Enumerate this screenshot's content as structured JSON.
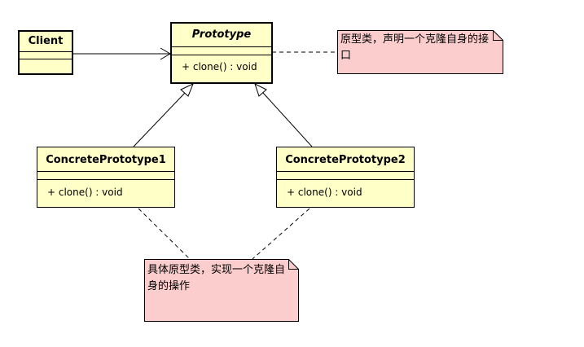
{
  "classes": {
    "client": {
      "name": "Client"
    },
    "prototype": {
      "name": "Prototype",
      "operation": "+ clone() : void"
    },
    "concrete1": {
      "name": "ConcretePrototype1",
      "operation": "+ clone() : void"
    },
    "concrete2": {
      "name": "ConcretePrototype2",
      "operation": "+ clone() : void"
    }
  },
  "notes": {
    "prototype_note": "原型类，声明一个克隆自身的接口",
    "concrete_note": "具体原型类，实现一个克隆自身的操作"
  },
  "colors": {
    "class_fill": "#ffffc8",
    "note_fill": "#fbcdcd",
    "line": "#000000"
  }
}
